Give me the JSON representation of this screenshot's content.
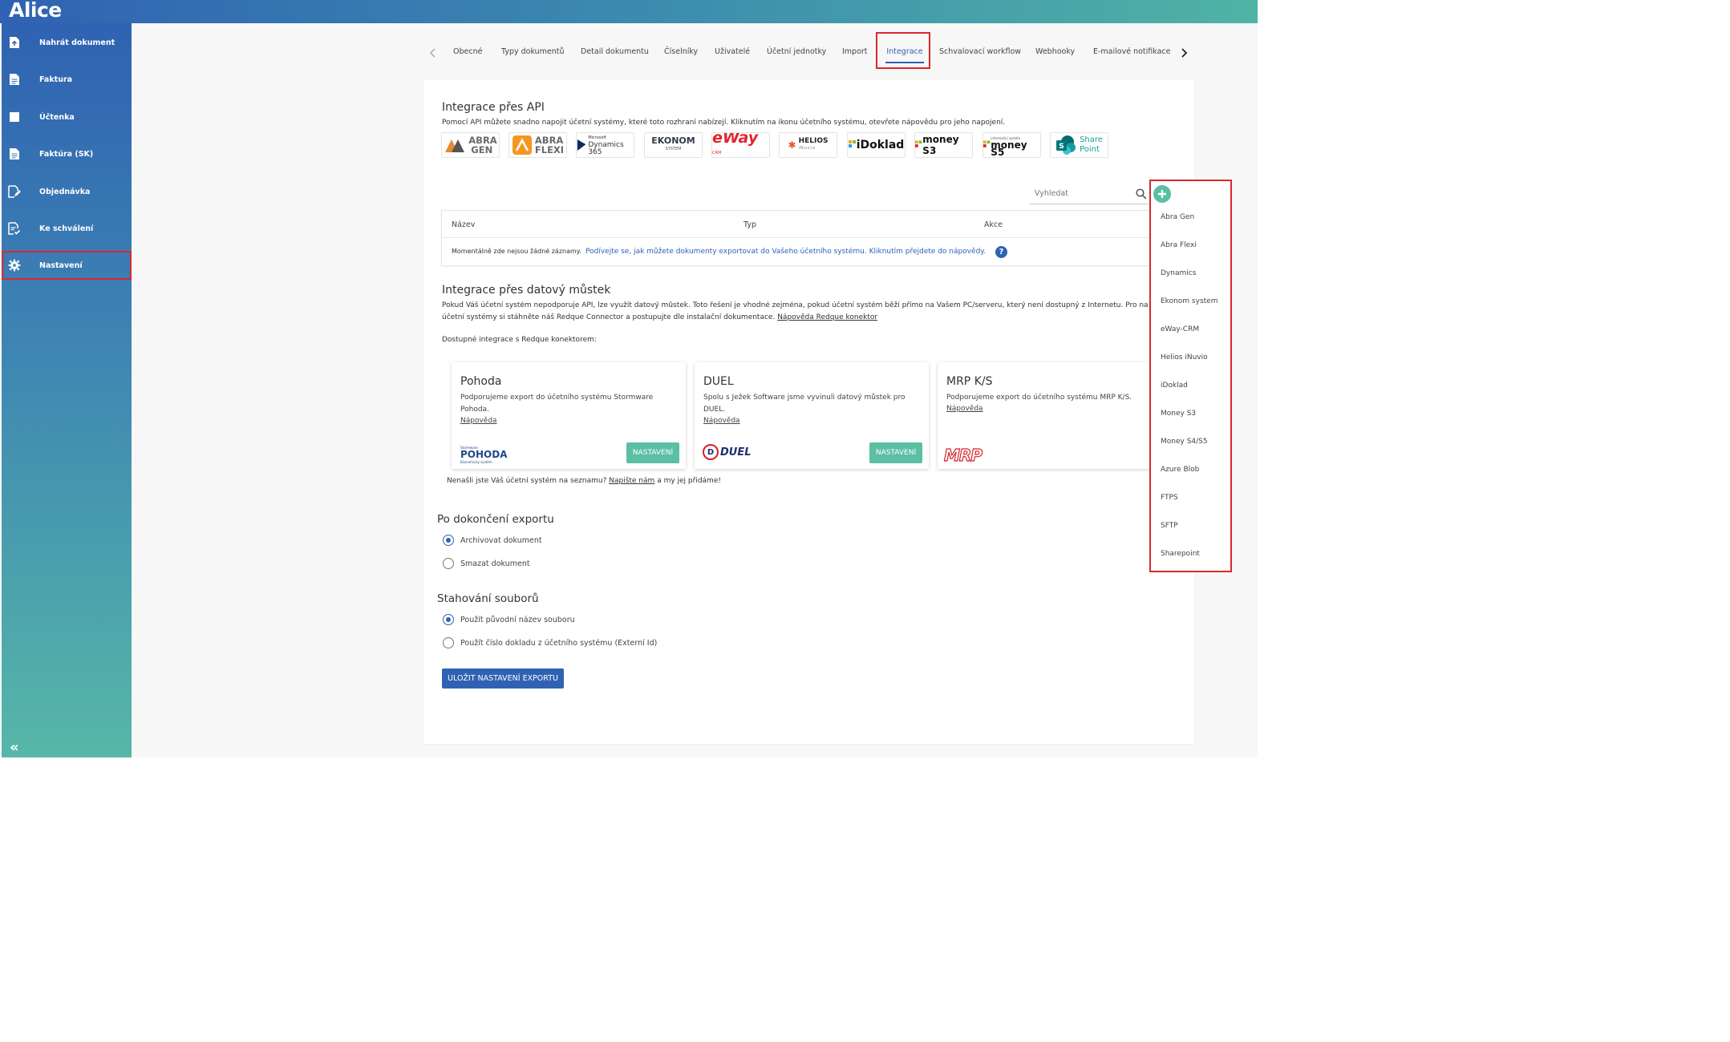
{
  "app": {
    "title": "Alice"
  },
  "sidebar": {
    "items": [
      {
        "label": "Nahrát dokument",
        "icon": "upload-icon"
      },
      {
        "label": "Faktura",
        "icon": "document-icon"
      },
      {
        "label": "Účtenka",
        "icon": "receipt-icon"
      },
      {
        "label": "Faktúra (SK)",
        "icon": "document-icon"
      },
      {
        "label": "Objednávka",
        "icon": "order-icon"
      },
      {
        "label": "Ke schválení",
        "icon": "approve-icon"
      },
      {
        "label": "Nastavení",
        "icon": "gear-icon",
        "active": true
      }
    ],
    "collapse_label": "«"
  },
  "tabs": [
    {
      "label": "Obecné"
    },
    {
      "label": "Typy dokumentů"
    },
    {
      "label": "Detail dokumentu"
    },
    {
      "label": "Číselníky"
    },
    {
      "label": "Uživatelé"
    },
    {
      "label": "Účetní jednotky"
    },
    {
      "label": "Import"
    },
    {
      "label": "Integrace",
      "active": true
    },
    {
      "label": "Schvalovací workflow"
    },
    {
      "label": "Webhooky"
    },
    {
      "label": "E-mailové notifikace"
    }
  ],
  "api": {
    "title": "Integrace přes API",
    "desc": "Pomocí API můžete snadno napojit účetní systémy, které toto rozhraní nabízejí. Kliknutím na ikonu účetního systému, otevřete nápovědu pro jeho napojení.",
    "logos": {
      "abragen_1": "ABRA",
      "abragen_2": "GEN",
      "abraflexi_1": "ABRA",
      "abraflexi_2": "FLEXI",
      "dynamics_small": "Microsoft",
      "dynamics": "Dynamics 365",
      "ekonom": "EKONOM",
      "ekonom_sub": "SYSTEM",
      "eway": "eWay",
      "eway_sub": "CRM",
      "helios": "HELIOS",
      "helios_sub": "iNuvio",
      "idoklad": "iDoklad",
      "moneys3": "money S3",
      "moneys5_small": "informační systém",
      "moneys5": "money S5",
      "sharepoint_1": "Share",
      "sharepoint_2": "Point"
    }
  },
  "search": {
    "placeholder": "Vyhledat"
  },
  "table": {
    "headers": [
      "Název",
      "Typ",
      "Akce"
    ],
    "empty": "Momentálně zde nejsou žádné záznamy.",
    "help_link": "Podívejte se, jak můžete dokumenty exportovat do Vašeho účetního systému. Kliknutím přejdete do nápovědy."
  },
  "bridge": {
    "title": "Integrace přes datový můstek",
    "desc_1": "Pokud Váš účetní systém nepodporuje API, lze využít datový můstek. Toto řešení je vhodné zejména, pokud účetní systém běží přímo na Vašem PC/serveru, který není dostupný z Internetu. Pro na",
    "desc_2": "účetní systémy si stáhněte náš Redque Connector a postupujte dle instalační dokumentace.",
    "desc_link": "Nápověda Redque konektor",
    "available": "Dostupné integrace s Redque konektorem:",
    "cards": [
      {
        "title": "Pohoda",
        "desc": "Podporujeme export do účetního systému Stormware Pohoda.",
        "help": "Nápověda",
        "button": "NASTAVENÍ",
        "logo": "POHODA",
        "logo_sub": "Ekonomický systém",
        "logo_top": "Stormware"
      },
      {
        "title": "DUEL",
        "desc": "Spolu s Ježek Software jsme vyvinuli datový můstek pro DUEL.",
        "help": "Nápověda",
        "button": "NASTAVENÍ",
        "logo": "DUEL",
        "logo_letter": "D"
      },
      {
        "title": "MRP K/S",
        "desc": "Podporujeme export do účetního systému MRP K/S.",
        "help": "Nápověda",
        "logo": "MRP"
      }
    ],
    "missing_1": "Nenašli jste Váš účetní systém na seznamu?",
    "missing_link": "Napište nám",
    "missing_2": "a my jej přidáme!"
  },
  "after_export": {
    "title": "Po dokončení exportu",
    "options": [
      {
        "label": "Archivovat dokument",
        "checked": true
      },
      {
        "label": "Smazat dokument",
        "checked": false
      }
    ]
  },
  "download": {
    "title": "Stahování souborů",
    "options": [
      {
        "label": "Použít původní název souboru",
        "checked": true
      },
      {
        "label": "Použít číslo dokladu z účetního systému (Externí Id)",
        "checked": false
      }
    ]
  },
  "save_button": "ULOŽIT NASTAVENÍ EXPORTU",
  "dropdown": {
    "items": [
      "Abra Gen",
      "Abra Flexi",
      "Dynamics",
      "Ekonom system",
      "eWay-CRM",
      "Helios iNuvio",
      "iDoklad",
      "Money S3",
      "Money S4/S5",
      "Azure Blob",
      "FTPS",
      "SFTP",
      "Sharepoint"
    ]
  },
  "colors": {
    "primary": "#2f62b2",
    "accent": "#5bbfa4",
    "highlight": "#d9282f"
  }
}
